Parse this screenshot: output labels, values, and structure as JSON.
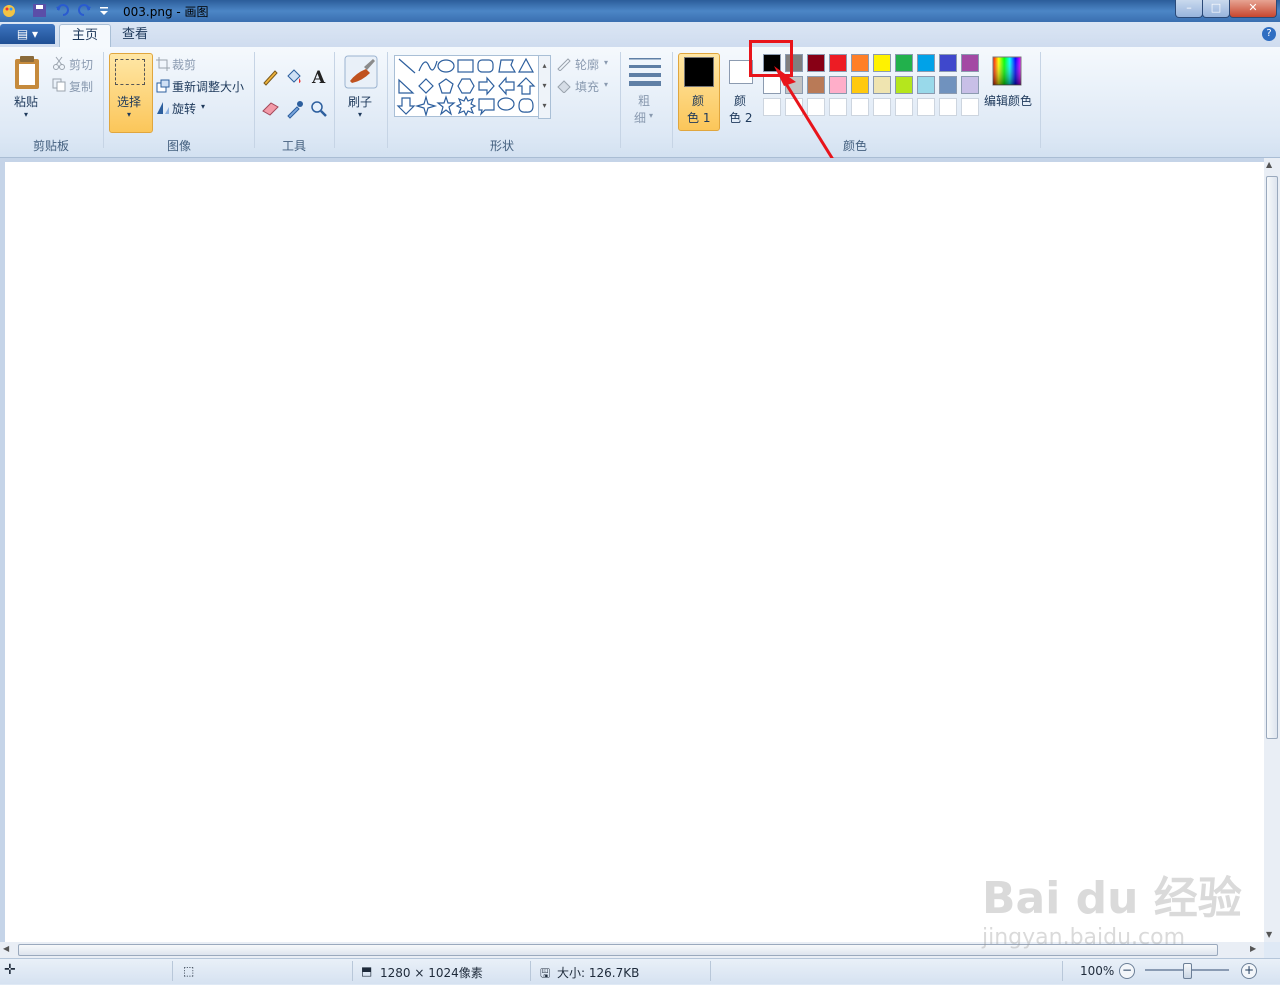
{
  "window": {
    "title": "003.png - 画图",
    "buttons": [
      "–",
      "□",
      "✕"
    ]
  },
  "tabs": {
    "menu": "▤ ▾",
    "home": "主页",
    "view": "查看"
  },
  "clipboard": {
    "paste": "粘贴",
    "cut": "剪切",
    "copy": "复制",
    "group": "剪贴板"
  },
  "image": {
    "select": "选择",
    "crop": "裁剪",
    "resize": "重新调整大小",
    "rotate": "旋转",
    "group": "图像"
  },
  "tools": {
    "group": "工具"
  },
  "brushes": {
    "label": "刷子"
  },
  "shapes": {
    "outline": "轮廓",
    "fill": "填充",
    "group": "形状"
  },
  "size": {
    "label_top": "粗",
    "label_bottom": "细"
  },
  "colors": {
    "color1_top": "颜",
    "color1_bottom": "色 1",
    "color2_top": "颜",
    "color2_bottom": "色 2",
    "edit": "编辑颜色",
    "group": "颜色",
    "color1_value": "#000000",
    "color2_value": "#ffffff",
    "row1": [
      "#000000",
      "#7f7f7f",
      "#880015",
      "#ed1c24",
      "#ff7f27",
      "#fff200",
      "#22b14c",
      "#00a2e8",
      "#3f48cc",
      "#a349a4"
    ],
    "row2": [
      "#ffffff",
      "#c3c3c3",
      "#b97a57",
      "#ffaec9",
      "#ffc90e",
      "#efe4b0",
      "#b5e61d",
      "#99d9ea",
      "#7092be",
      "#c8bfe7"
    ]
  },
  "annotation": {
    "color": "#e8141b"
  },
  "status": {
    "dimensions": "1280 × 1024像素",
    "size": "大小: 126.7KB",
    "zoom": "100%"
  },
  "watermark": {
    "brand": "Bai du 经验",
    "url": "jingyan.baidu.com"
  }
}
